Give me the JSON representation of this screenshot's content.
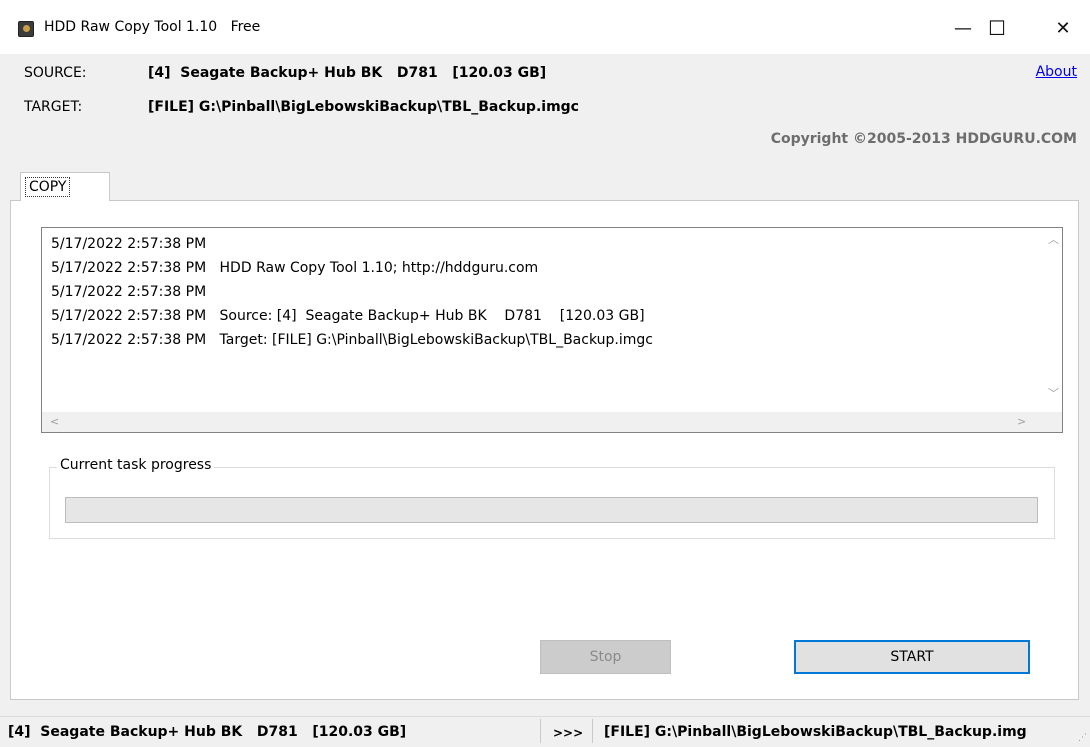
{
  "window": {
    "title": "HDD Raw Copy Tool 1.10   Free",
    "minimize_glyph": "—",
    "maximize_glyph": "☐",
    "close_glyph": "✕"
  },
  "header": {
    "source_label": "SOURCE:",
    "source_value": "[4]  Seagate Backup+ Hub BK   D781   [120.03 GB]",
    "target_label": "TARGET:",
    "target_value": "[FILE] G:\\Pinball\\BigLebowskiBackup\\TBL_Backup.imgc",
    "about_link": "About",
    "copyright": "Copyright ©2005-2013 HDDGURU.COM"
  },
  "tabs": [
    {
      "label": "COPY",
      "active": true
    }
  ],
  "log": {
    "lines": [
      "5/17/2022 2:57:38 PM",
      "5/17/2022 2:57:38 PM   HDD Raw Copy Tool 1.10; http://hddguru.com",
      "5/17/2022 2:57:38 PM",
      "5/17/2022 2:57:38 PM   Source: [4]  Seagate Backup+ Hub BK    D781    [120.03 GB]",
      "5/17/2022 2:57:38 PM   Target: [FILE] G:\\Pinball\\BigLebowskiBackup\\TBL_Backup.imgc"
    ]
  },
  "progress": {
    "group_title": "Current task progress",
    "fraction": 0
  },
  "buttons": {
    "stop_label": "Stop",
    "start_label": "START"
  },
  "statusbar": {
    "source": "[4]  Seagate Backup+ Hub BK   D781   [120.03 GB]",
    "arrow": ">>>",
    "target": "[FILE] G:\\Pinball\\BigLebowskiBackup\\TBL_Backup.img"
  },
  "colors": {
    "accent": "#0078d7",
    "link": "#0000ee",
    "copyright": "#6d6d6d"
  },
  "icons": [
    "app-icon",
    "minimize-icon",
    "maximize-icon",
    "close-icon",
    "scroll-up-icon",
    "scroll-down-icon",
    "scroll-left-icon",
    "scroll-right-icon",
    "resize-grip-icon"
  ]
}
